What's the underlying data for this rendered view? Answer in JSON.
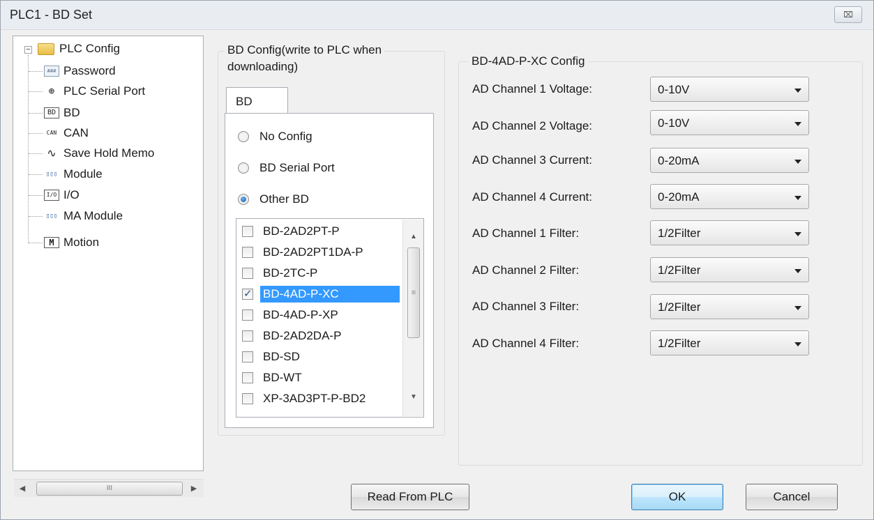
{
  "window": {
    "title": "PLC1 - BD Set",
    "close_symbol": "⌧"
  },
  "tree": {
    "root": "PLC Config",
    "expander": "−",
    "items": [
      {
        "label": "Password",
        "icon": "password-icon",
        "glyph": "###"
      },
      {
        "label": "PLC Serial Port",
        "icon": "serial-port-icon",
        "glyph": "⊕"
      },
      {
        "label": "BD",
        "icon": "bd-icon",
        "glyph": "BD"
      },
      {
        "label": "CAN",
        "icon": "can-icon",
        "glyph": "CAN"
      },
      {
        "label": "Save Hold Memo",
        "icon": "waveform-icon",
        "glyph": "∿"
      },
      {
        "label": "Module",
        "icon": "module-icon",
        "glyph": "▯▯▯"
      },
      {
        "label": "I/O",
        "icon": "io-icon",
        "glyph": "I/O"
      },
      {
        "label": "MA Module",
        "icon": "ma-module-icon",
        "glyph": "▯▯▯"
      },
      {
        "label": "Motion",
        "icon": "motion-icon",
        "glyph": "M"
      }
    ],
    "scroll_left": "◀",
    "scroll_right": "▶",
    "scroll_grip": "III"
  },
  "bd_config": {
    "title_line1": "BD Config(write to PLC when",
    "title_line2": "downloading)",
    "tab_label": "BD",
    "radios": [
      {
        "label": "No Config",
        "checked": false
      },
      {
        "label": "BD Serial Port",
        "checked": false
      },
      {
        "label": "Other BD",
        "checked": true
      }
    ],
    "list": [
      {
        "label": "BD-2AD2PT-P",
        "checked": false,
        "selected": false
      },
      {
        "label": "BD-2AD2PT1DA-P",
        "checked": false,
        "selected": false
      },
      {
        "label": "BD-2TC-P",
        "checked": false,
        "selected": false
      },
      {
        "label": "BD-4AD-P-XC",
        "checked": true,
        "selected": true
      },
      {
        "label": "BD-4AD-P-XP",
        "checked": false,
        "selected": false
      },
      {
        "label": "BD-2AD2DA-P",
        "checked": false,
        "selected": false
      },
      {
        "label": "BD-SD",
        "checked": false,
        "selected": false
      },
      {
        "label": "BD-WT",
        "checked": false,
        "selected": false
      },
      {
        "label": "XP-3AD3PT-P-BD2",
        "checked": false,
        "selected": false
      }
    ],
    "scroll_up": "▲",
    "scroll_down": "▼",
    "scroll_grip": "≡"
  },
  "module_config": {
    "title": "BD-4AD-P-XC Config",
    "fields": [
      {
        "label": "AD Channel 1 Voltage:",
        "value": "0-10V"
      },
      {
        "label": "AD Channel 2 Voltage:",
        "value": "0-10V"
      },
      {
        "label": "AD Channel 3 Current:",
        "value": "0-20mA"
      },
      {
        "label": "AD Channel 4 Current:",
        "value": "0-20mA"
      },
      {
        "label": "AD Channel 1 Filter:",
        "value": "1/2Filter"
      },
      {
        "label": "AD Channel 2 Filter:",
        "value": "1/2Filter"
      },
      {
        "label": "AD Channel 3 Filter:",
        "value": "1/2Filter"
      },
      {
        "label": "AD Channel 4 Filter:",
        "value": "1/2Filter"
      }
    ]
  },
  "buttons": {
    "read_from_plc": "Read From PLC",
    "ok": "OK",
    "cancel": "Cancel"
  }
}
